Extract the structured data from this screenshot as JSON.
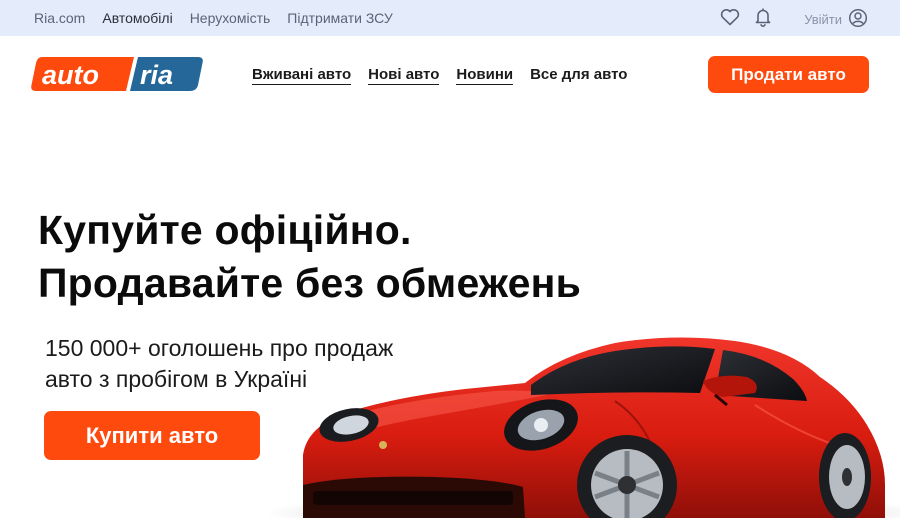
{
  "topbar": {
    "links": [
      "Ria.com",
      "Автомобілі",
      "Нерухомість",
      "Підтримати ЗСУ"
    ],
    "login_label": "Увійти",
    "icons": [
      "heart-icon",
      "bell-icon",
      "user-circle-icon"
    ]
  },
  "header": {
    "logo_text_left": "auto",
    "logo_text_right": "ria",
    "nav": [
      "Вживані авто",
      "Нові авто",
      "Новини",
      "Все для авто"
    ],
    "sell_label": "Продати авто"
  },
  "hero": {
    "title_line1": "Купуйте офіційно.",
    "title_line2": "Продавайте без обмежень",
    "subtitle_line1": "150 000+ оголошень про продаж",
    "subtitle_line2": "авто з пробігом в Україні",
    "buy_label": "Купити авто"
  },
  "colors": {
    "accent": "#ff4a0d",
    "topbar_bg": "#e4ecfb",
    "logo_blue": "#256799",
    "car_red": "#d81c10"
  }
}
